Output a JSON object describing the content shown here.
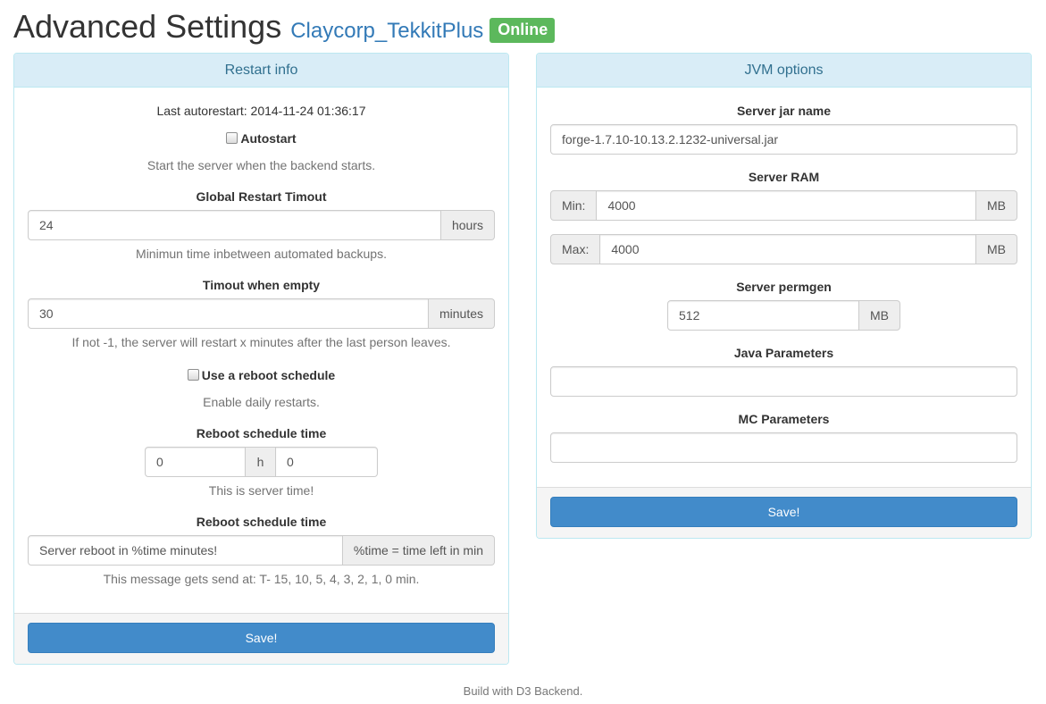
{
  "header": {
    "title": "Advanced Settings",
    "server_name": "Claycorp_TekkitPlus",
    "status": "Online",
    "status_color": "#5cb85c"
  },
  "restart_panel": {
    "heading": "Restart info",
    "last_autorestart": "Last autorestart: 2014-11-24 01:36:17",
    "autostart_label": "Autostart",
    "autostart_checked": false,
    "autostart_help": "Start the server when the backend starts.",
    "global_timeout_label": "Global Restart Timout",
    "global_timeout_value": "24",
    "global_timeout_unit": "hours",
    "global_timeout_help": "Minimun time inbetween automated backups.",
    "empty_timeout_label": "Timout when empty",
    "empty_timeout_value": "30",
    "empty_timeout_unit": "minutes",
    "empty_timeout_help": "If not -1, the server will restart x minutes after the last person leaves.",
    "reboot_schedule_label": "Use a reboot schedule",
    "reboot_schedule_checked": false,
    "reboot_schedule_help": "Enable daily restarts.",
    "reboot_time_label": "Reboot schedule time",
    "reboot_hour_value": "0",
    "reboot_hour_sep": "h",
    "reboot_minute_value": "0",
    "reboot_time_help": "This is server time!",
    "reboot_message_label": "Reboot schedule time",
    "reboot_message_value": "Server reboot in %time minutes!",
    "reboot_message_addon": "%time = time left in min",
    "reboot_message_help": "This message gets send at: T- 15, 10, 5, 4, 3, 2, 1, 0 min.",
    "save_label": "Save!"
  },
  "jvm_panel": {
    "heading": "JVM options",
    "jar_label": "Server jar name",
    "jar_value": "forge-1.7.10-10.13.2.1232-universal.jar",
    "ram_label": "Server RAM",
    "ram_min_addon": "Min:",
    "ram_min_value": "4000",
    "ram_min_unit": "MB",
    "ram_max_addon": "Max:",
    "ram_max_value": "4000",
    "ram_max_unit": "MB",
    "permgen_label": "Server permgen",
    "permgen_value": "512",
    "permgen_unit": "MB",
    "java_params_label": "Java Parameters",
    "java_params_value": "",
    "mc_params_label": "MC Parameters",
    "mc_params_value": "",
    "save_label": "Save!"
  },
  "footer": {
    "text": "Build with D3 Backend."
  }
}
